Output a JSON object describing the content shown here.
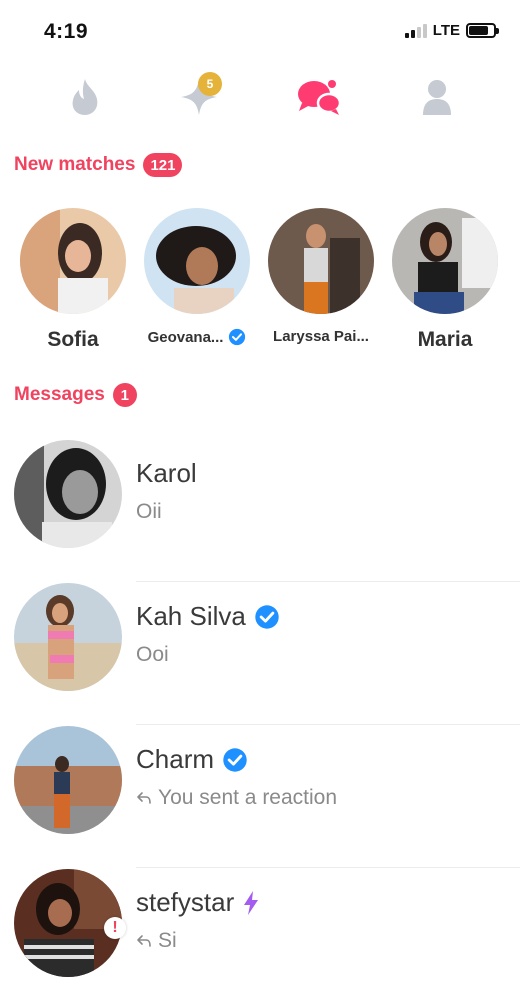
{
  "status_bar": {
    "time": "4:19",
    "network": "LTE"
  },
  "nav": {
    "flame_icon": "flame-icon",
    "sparkle_icon": "sparkle-icon",
    "sparkle_badge": "5",
    "chat_icon": "chat-icon",
    "profile_icon": "profile-icon",
    "accent": "#fe3c72"
  },
  "matches": {
    "label": "New matches",
    "count": "121",
    "items": [
      {
        "name": "Sofia",
        "verified": false
      },
      {
        "name": "Geovana...",
        "verified": true
      },
      {
        "name": "Laryssa Pai...",
        "verified": false
      },
      {
        "name": "Maria",
        "verified": false
      }
    ]
  },
  "messages": {
    "label": "Messages",
    "count": "1",
    "items": [
      {
        "name": "Karol",
        "preview": "Oii",
        "verified": false,
        "replied": false
      },
      {
        "name": "Kah Silva",
        "preview": "Ooi",
        "verified": true,
        "replied": false
      },
      {
        "name": "Charm",
        "preview": "You sent a reaction",
        "verified": true,
        "replied": true
      },
      {
        "name": "stefystar",
        "preview": "Si",
        "verified": false,
        "replied": true,
        "boost_icon": "lightning-icon",
        "alert": "!"
      }
    ]
  },
  "colors": {
    "brand": "#f0435f",
    "verified": "#1e90ff",
    "inactive_icon": "#c5cad3",
    "boost": "#a35bf0"
  }
}
